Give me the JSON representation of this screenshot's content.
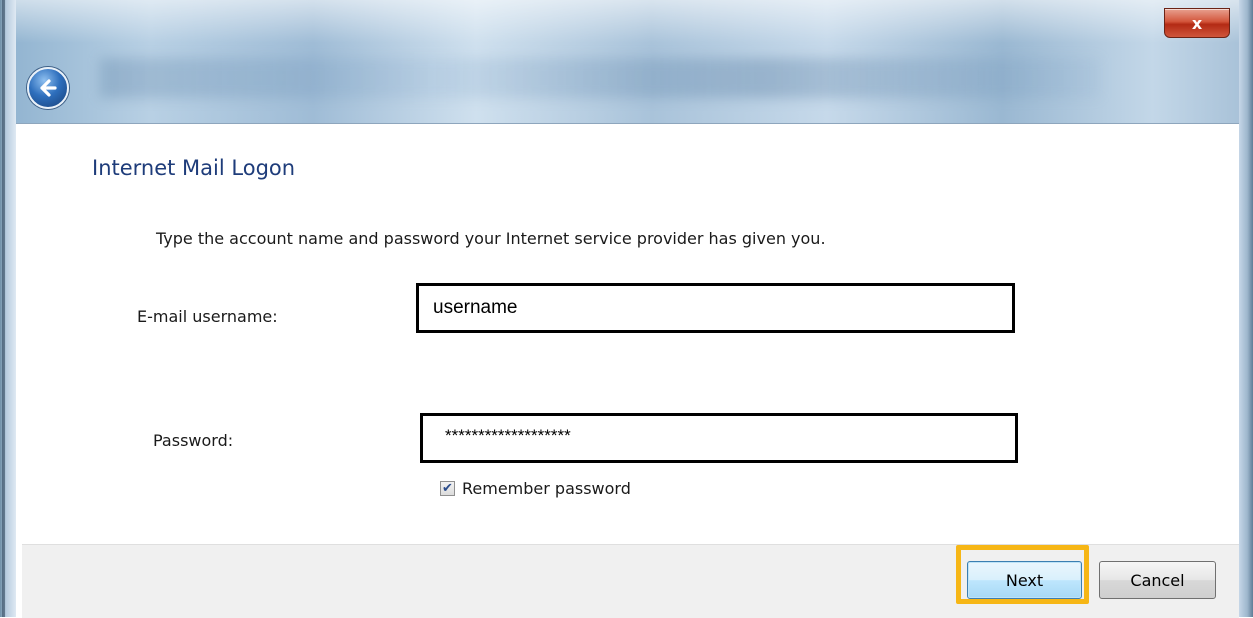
{
  "window": {
    "close_glyph": "x",
    "back_icon": "back-arrow-icon"
  },
  "page": {
    "title": "Internet Mail Logon",
    "instructions": "Type the account name and password your Internet service provider has given you."
  },
  "form": {
    "username_label": "E-mail username:",
    "username_value": "username",
    "password_label": "Password:",
    "password_value": "*******************",
    "remember_label": "Remember password",
    "remember_checked": true
  },
  "footer": {
    "next_label": "Next",
    "cancel_label": "Cancel"
  },
  "colors": {
    "title_text": "#1e3c7a",
    "highlight": "#f6b615"
  }
}
